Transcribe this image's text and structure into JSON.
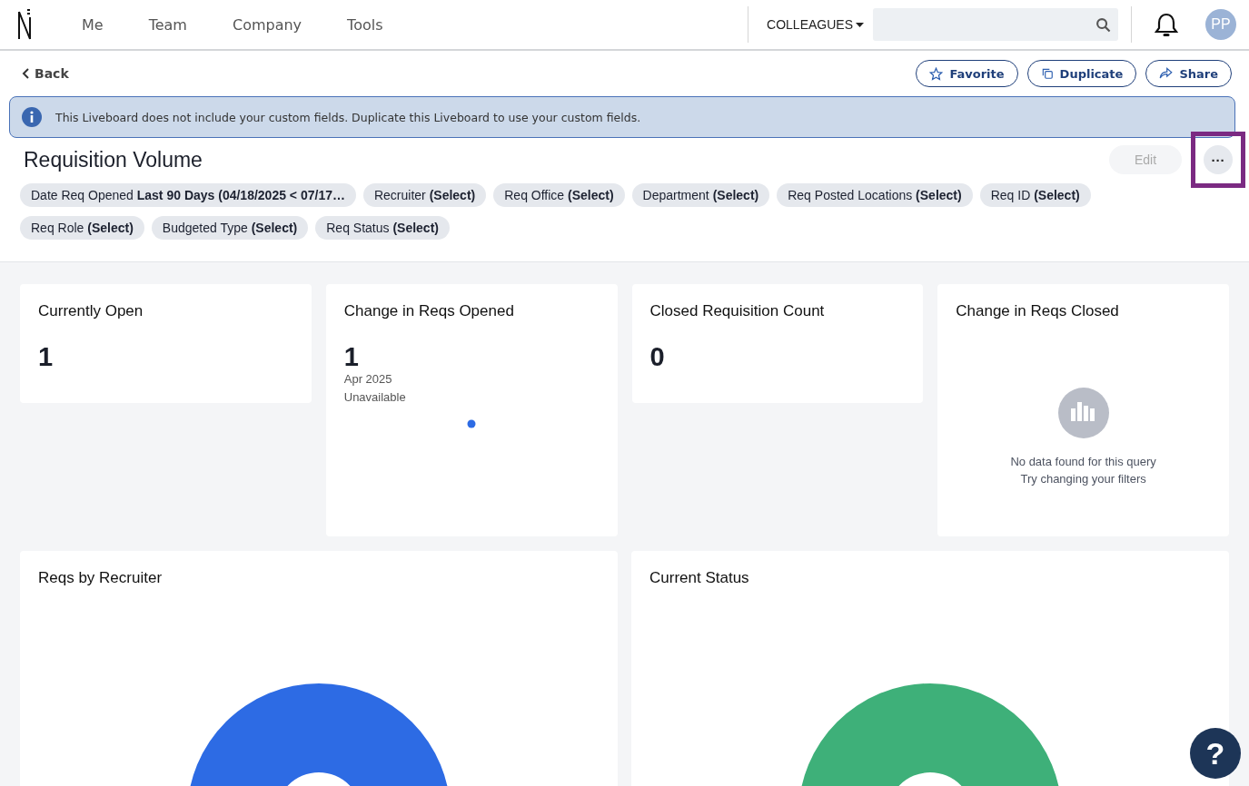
{
  "nav": {
    "items": [
      {
        "label": "Me",
        "selected": false
      },
      {
        "label": "Team",
        "selected": false
      },
      {
        "label": "Company",
        "selected": false
      },
      {
        "label": "Tools",
        "selected": false
      }
    ],
    "scope": "COLLEAGUES",
    "avatar": "PP"
  },
  "actions": {
    "back": "Back",
    "buttons": [
      {
        "kind": "favorite",
        "label": "Favorite"
      },
      {
        "kind": "duplicate",
        "label": "Duplicate"
      },
      {
        "kind": "share",
        "label": "Share"
      }
    ]
  },
  "banner": "This Liveboard does not include your custom fields. Duplicate this Liveboard to use your custom fields.",
  "title": "Requisition Volume",
  "edit": {
    "label": "Edit",
    "disabled": true
  },
  "more_button": {
    "label": "···",
    "highlighted": true
  },
  "filters": [
    "Date Req Opened **Last 90 Days (04/18/2025 < 07/17…**",
    "Recruiter **(Select)**",
    "Req Office **(Select)**",
    "Department **(Select)**",
    "Req Posted Locations **(Select)**",
    "Req ID **(Select)**",
    "Req Role **(Select)**",
    "Budgeted Type **(Select)**",
    "Req Status **(Select)**"
  ],
  "tiles": [
    {
      "kind": "metric",
      "title": "Currently Open",
      "value": "1"
    },
    {
      "kind": "trend",
      "title": "Change in Reqs Opened",
      "value": "1",
      "period": "Apr 2025",
      "note": "Unavailable"
    },
    {
      "kind": "metric",
      "title": "Closed Requisition Count",
      "value": "0"
    },
    {
      "kind": "empty",
      "title": "Change in Reqs Closed",
      "message": "No data found for this query",
      "hint": "Try changing your filters"
    }
  ],
  "charts": [
    {
      "title": "Reqs by Recruiter",
      "color": "#2d6be4"
    },
    {
      "title": "Current Status",
      "color": "#3eb079"
    }
  ],
  "help": "?"
}
